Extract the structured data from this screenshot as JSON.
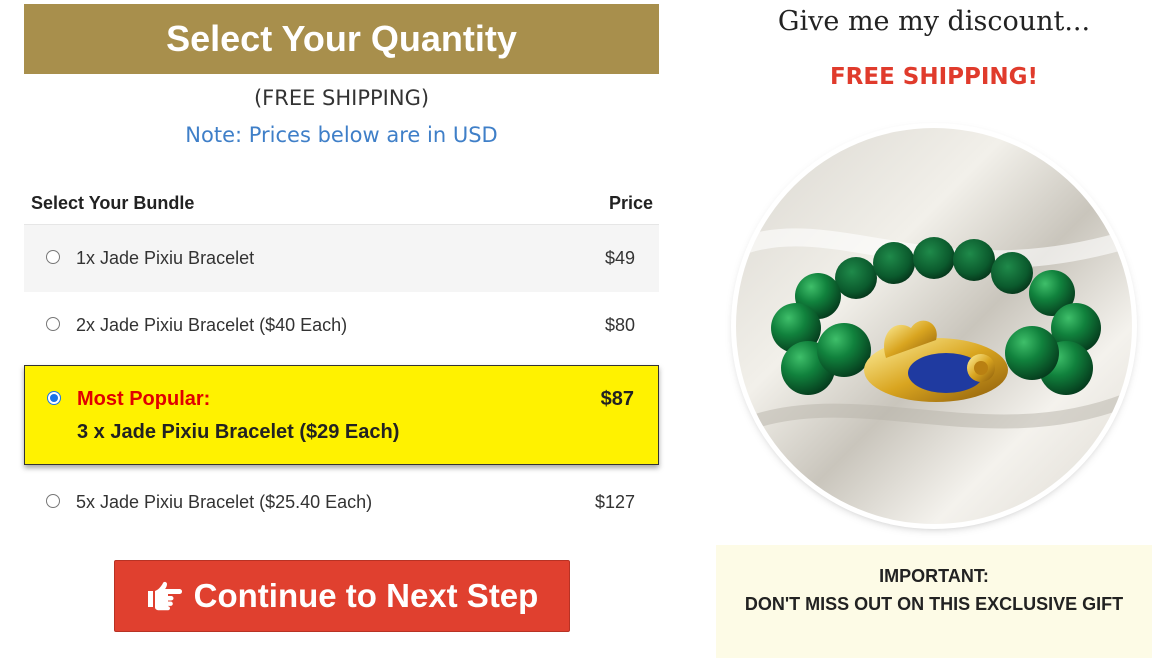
{
  "header": {
    "title": "Select Your Quantity"
  },
  "shipping_note": "(FREE SHIPPING)",
  "currency_note": "Note: Prices below are in USD",
  "bundle_table": {
    "col_bundle": "Select Your Bundle",
    "col_price": "Price",
    "options": [
      {
        "label": "1x Jade Pixiu Bracelet",
        "price": "$49",
        "selected": false
      },
      {
        "label": "2x Jade Pixiu Bracelet ($40 Each)",
        "price": "$80",
        "selected": false
      },
      {
        "badge": "Most Popular:",
        "label": "3 x Jade Pixiu Bracelet ($29 Each)",
        "price": "$87",
        "selected": true
      },
      {
        "label": "5x Jade Pixiu Bracelet ($25.40 Each)",
        "price": "$127",
        "selected": false
      }
    ]
  },
  "cta": {
    "label": "Continue to Next Step",
    "icon": "pointing-hand-icon",
    "color": "#e0402f"
  },
  "discount_heading": "Give me my discount...",
  "free_shipping": "FREE SHIPPING!",
  "product_image": {
    "alt": "jade-pixiu-bracelet"
  },
  "important": {
    "line1": "IMPORTANT:",
    "line2": "DON'T MISS OUT ON THIS EXCLUSIVE GIFT"
  },
  "colors": {
    "header_bg": "#a88f4c",
    "note_blue": "#3f7fc8",
    "popular_bg": "#fff200",
    "popular_text": "#e00000",
    "free_shipping_red": "#e03b2c"
  }
}
